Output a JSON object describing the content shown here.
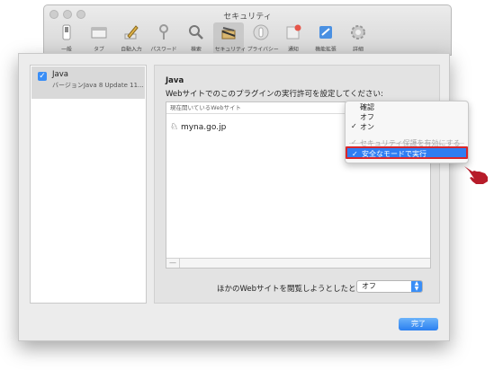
{
  "prefs": {
    "title": "セキュリティ",
    "toolbar": [
      {
        "label": "一般",
        "icon": "switch-icon"
      },
      {
        "label": "タブ",
        "icon": "tabs-icon"
      },
      {
        "label": "自動入力",
        "icon": "pencil-icon"
      },
      {
        "label": "パスワード",
        "icon": "key-icon"
      },
      {
        "label": "検索",
        "icon": "search-icon"
      },
      {
        "label": "セキュリティ",
        "icon": "shield-icon"
      },
      {
        "label": "プライバシー",
        "icon": "hand-icon"
      },
      {
        "label": "通知",
        "icon": "bell-icon"
      },
      {
        "label": "機能拡張",
        "icon": "puzzle-icon"
      },
      {
        "label": "詳細",
        "icon": "gear-icon"
      }
    ]
  },
  "plugin": {
    "name": "Java",
    "version": "バージョンJava 8 Update 11..."
  },
  "detail": {
    "title": "Java",
    "description": "Webサイトでのこのプラグインの実行許可を設定してください:",
    "table_header": "現在開いているWebサイト",
    "site": "myna.go.jp",
    "other_label": "ほかのWebサイトを閲覧しようとしたとき:",
    "other_value": "オフ"
  },
  "menu": {
    "items": [
      "確認",
      "オフ",
      "オン"
    ],
    "checked": "✓",
    "disabled_item": "セキュリティ保護を有効にする",
    "selected_item": "安全なモードで実行"
  },
  "done_label": "完了",
  "colors": {
    "accent": "#2f7df2",
    "highlight_border": "#d9262b",
    "pointer": "#b71c2a"
  }
}
